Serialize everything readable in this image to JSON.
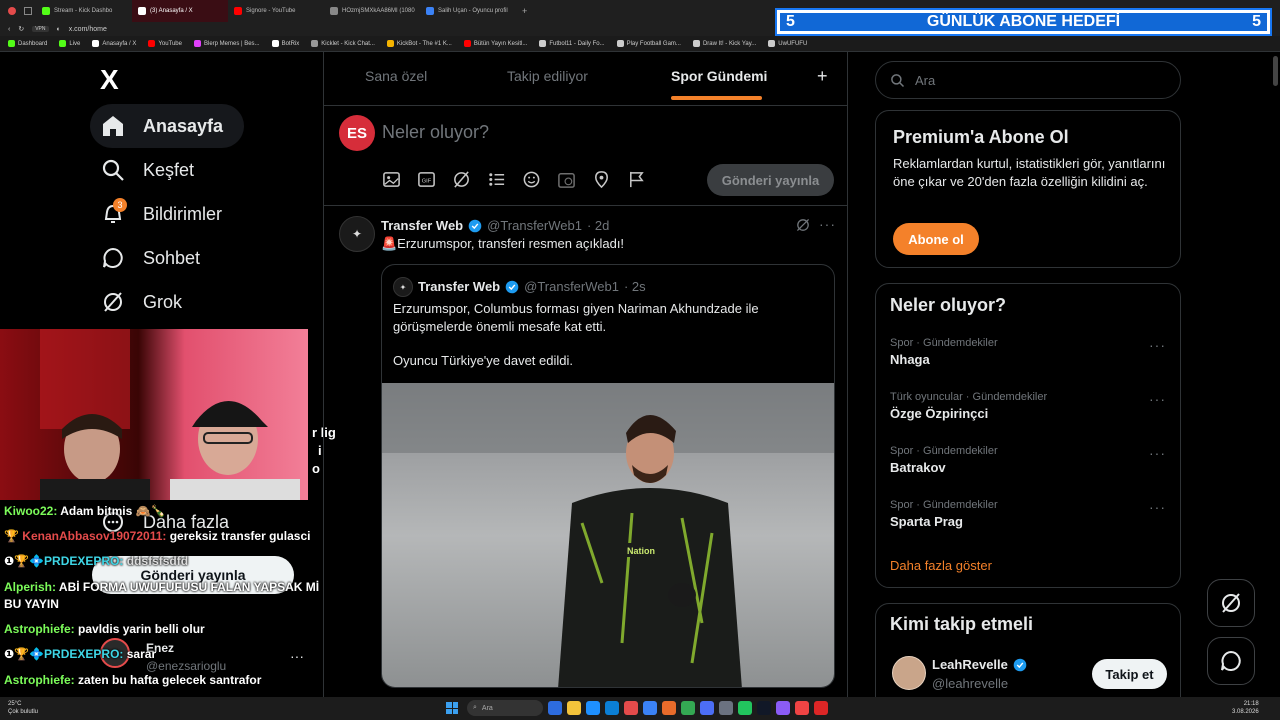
{
  "goal": {
    "left_count": "5",
    "title": "GÜNLÜK ABONE HEDEFİ",
    "right_count": "5"
  },
  "browser": {
    "tabs": [
      {
        "label": "Stream - Kick Dashbo",
        "color": "#53fc18"
      },
      {
        "label": "(3) Anasayfa / X",
        "color": "#ffffff"
      },
      {
        "label": "Signore - YouTube",
        "color": "#ff0000"
      },
      {
        "label": "HOzmjSMXkAA86MI (1080",
        "color": "#888888"
      },
      {
        "label": "Salih Uçan - Oyuncu profil",
        "color": "#3b82f6"
      }
    ],
    "add_tab": "+",
    "url": "x.com/home",
    "bookmarks": [
      {
        "label": "Dashboard",
        "color": "#53fc18"
      },
      {
        "label": "Live",
        "color": "#53fc18"
      },
      {
        "label": "Anasayfa / X",
        "color": "#ffffff"
      },
      {
        "label": "YouTube",
        "color": "#ff0000"
      },
      {
        "label": "Blerp Memes | Bes...",
        "color": "#e040fb"
      },
      {
        "label": "BotRix",
        "color": "#ffffff"
      },
      {
        "label": "Kicklet - Kick Chat...",
        "color": "#999999"
      },
      {
        "label": "KickBot - The #1 K...",
        "color": "#f5b400"
      },
      {
        "label": "Bütün Yayın Kesitl...",
        "color": "#ff0000"
      },
      {
        "label": "Futbol11 - Daily Fo...",
        "color": "#cccccc"
      },
      {
        "label": "Play Football Gam...",
        "color": "#cccccc"
      },
      {
        "label": "Draw It! - Kick Yay...",
        "color": "#cccccc"
      },
      {
        "label": "UwUFUFU",
        "color": "#cccccc"
      }
    ]
  },
  "nav": {
    "logo": "X",
    "items": [
      {
        "label": "Anasayfa",
        "icon": "home-icon",
        "active": true
      },
      {
        "label": "Keşfet",
        "icon": "search-icon"
      },
      {
        "label": "Bildirimler",
        "icon": "bell-icon",
        "badge": "3"
      },
      {
        "label": "Sohbet",
        "icon": "chat-icon"
      },
      {
        "label": "Grok",
        "icon": "grok-icon"
      }
    ],
    "more": "Daha fazla",
    "post_button": "Gönderi yayınla",
    "account": {
      "name": "Enez",
      "handle": "@enezsarioglu",
      "more": "···"
    }
  },
  "feed": {
    "tabs": [
      {
        "label": "Sana özel"
      },
      {
        "label": "Takip ediliyor"
      },
      {
        "label": "Spor Gündemi",
        "active": true
      }
    ],
    "add_tab": "+",
    "composer": {
      "avatar": "ES",
      "placeholder": "Neler oluyor?",
      "post_button": "Gönderi yayınla"
    },
    "tweet": {
      "name": "Transfer Web",
      "handle": "@TransferWeb1",
      "time": "· 2d",
      "text": "🚨Erzurumspor, transferi resmen açıkladı!",
      "quote": {
        "name": "Transfer Web",
        "handle": "@TransferWeb1",
        "time": "· 2s",
        "text1": "Erzurumspor, Columbus forması giyen Nariman Akhundzade ile görüşmelerde önemli mesafe kat etti.",
        "text2": "Oyuncu Türkiye'ye davet edildi."
      }
    }
  },
  "right": {
    "search_placeholder": "Ara",
    "premium": {
      "title": "Premium'a Abone Ol",
      "text": "Reklamlardan kurtul, istatistikleri gör, yanıtlarını öne çıkar ve 20'den fazla özelliğin kilidini aç.",
      "button": "Abone ol"
    },
    "trends": {
      "title": "Neler oluyor?",
      "items": [
        {
          "category": "Spor · Gündemdekiler",
          "name": "Nhaga"
        },
        {
          "category": "Türk oyuncular · Gündemdekiler",
          "name": "Özge Özpirinçci"
        },
        {
          "category": "Spor · Gündemdekiler",
          "name": "Batrakov"
        },
        {
          "category": "Spor · Gündemdekiler",
          "name": "Sparta Prag"
        }
      ],
      "more": "Daha fazla göster"
    },
    "follow": {
      "title": "Kimi takip etmeli",
      "name": "LeahRevelle",
      "handle": "@leahrevelle",
      "button": "Takip et"
    }
  },
  "chat": {
    "partial_lines": [
      "r lig",
      "i",
      "o"
    ],
    "messages": [
      {
        "user": "Kiwoo22:",
        "text": "Adam bitmis 🙈🍾",
        "color": "#7cfc5a"
      },
      {
        "user": "KenanAbbasov19072011:",
        "text": "gereksiz transfer gulasci",
        "color": "#e44b4b"
      },
      {
        "user": "PRDEXEPRO:",
        "text": "ddsfsfsdfd",
        "color": "#3ed6e6"
      },
      {
        "user": "Alperish:",
        "text": "ABİ FORMA UWUFUFUSU FALAN YAPSAK Mİ BU YAYIN",
        "color": "#7cfc5a"
      },
      {
        "user": "Astrophiefe:",
        "text": "pavldis yarin belli olur",
        "color": "#7cfc5a"
      },
      {
        "user": "PRDEXEPRO:",
        "text": "sarar",
        "color": "#3ed6e6"
      },
      {
        "user": "Astrophiefe:",
        "text": "zaten bu hafta gelecek santrafor",
        "color": "#7cfc5a"
      }
    ]
  },
  "taskbar": {
    "weather_temp": "25°C",
    "weather_text": "Çok bulutlu",
    "search": "Ara",
    "time": "21:18",
    "date": "3.08.2026"
  },
  "colors": {
    "accent": "#1d9bf0",
    "trend_more": "#f4812a",
    "abone_button": "#f4812a",
    "tab_underline": "#f4812a"
  }
}
